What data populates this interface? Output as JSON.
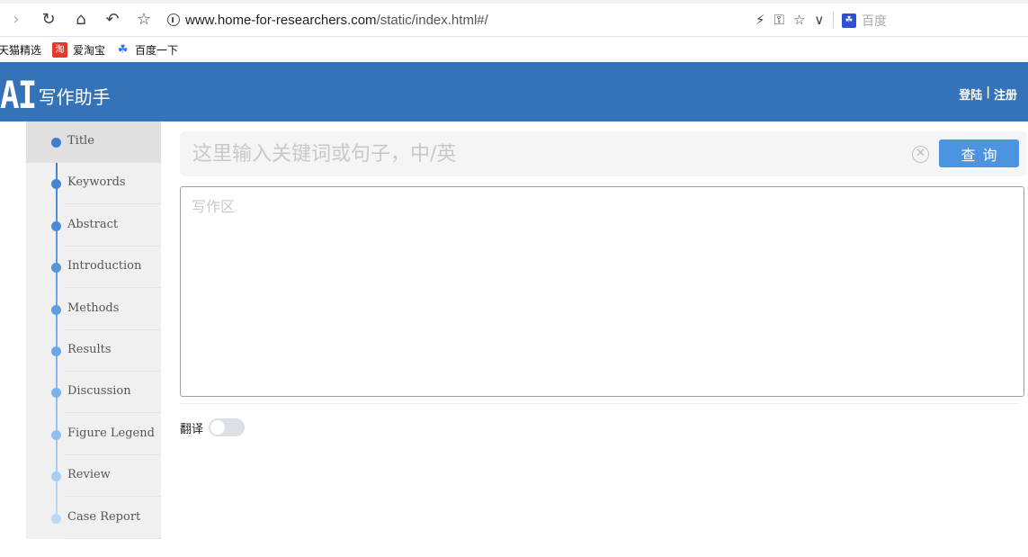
{
  "browser": {
    "url_domain": "www.home-for-researchers.com",
    "url_path": "/static/index.html#/",
    "search_engine": "百度",
    "bookmarks": [
      "天猫精选",
      "爱淘宝",
      "百度一下"
    ]
  },
  "header": {
    "logo_mark": "AI",
    "logo_name": "写作助手",
    "login": "登陆",
    "auth_sep": "|",
    "register": "注册",
    "color": "#3473b9"
  },
  "sidebar": {
    "items": [
      {
        "label": "Title",
        "active": true
      },
      {
        "label": "Keywords"
      },
      {
        "label": "Abstract"
      },
      {
        "label": "Introduction"
      },
      {
        "label": "Methods"
      },
      {
        "label": "Results"
      },
      {
        "label": "Discussion"
      },
      {
        "label": "Figure Legend"
      },
      {
        "label": "Review"
      },
      {
        "label": "Case Report"
      }
    ],
    "dot_colors": [
      "#3f7fd2",
      "#4485d5",
      "#4a8bd9",
      "#5394dc",
      "#5e9de1",
      "#6aa6e6",
      "#79b2ec",
      "#8ebff1",
      "#a6cdf5",
      "#b9d9f8"
    ]
  },
  "search": {
    "placeholder": "这里输入关键词或句子，中/英",
    "button": "查询"
  },
  "editor": {
    "placeholder": "写作区"
  },
  "translate": {
    "label": "翻译",
    "enabled": false
  }
}
